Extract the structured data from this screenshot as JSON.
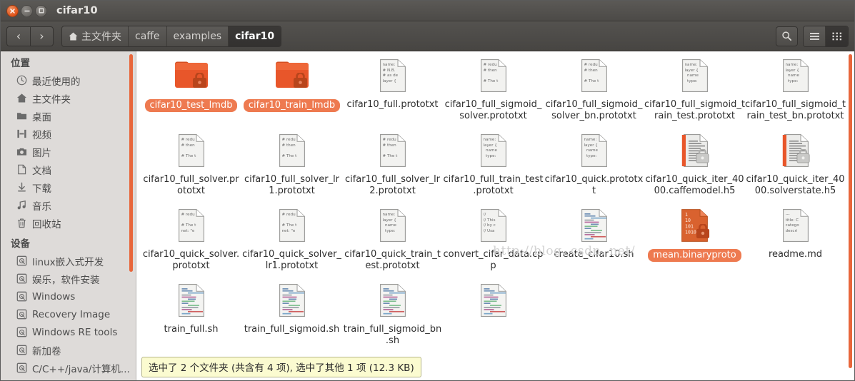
{
  "window": {
    "title": "cifar10",
    "controls": {
      "close": "×",
      "minimize": "−",
      "maximize": "□"
    }
  },
  "toolbar": {
    "back_label": "‹",
    "forward_label": "›",
    "breadcrumbs": [
      {
        "label": "主文件夹",
        "icon": "home-icon",
        "active": false
      },
      {
        "label": "caffe",
        "icon": "",
        "active": false
      },
      {
        "label": "examples",
        "icon": "",
        "active": false
      },
      {
        "label": "cifar10",
        "icon": "",
        "active": true
      }
    ],
    "search_icon": "search-icon",
    "list_view_icon": "list-view-icon",
    "grid_view_icon": "grid-view-icon",
    "active_view": "grid"
  },
  "sidebar": {
    "sections": [
      {
        "title": "位置",
        "items": [
          {
            "label": "最近使用的",
            "icon": "clock-icon"
          },
          {
            "label": "主文件夹",
            "icon": "home-icon"
          },
          {
            "label": "桌面",
            "icon": "folder-icon"
          },
          {
            "label": "视频",
            "icon": "video-icon"
          },
          {
            "label": "图片",
            "icon": "camera-icon"
          },
          {
            "label": "文档",
            "icon": "document-icon"
          },
          {
            "label": "下载",
            "icon": "download-icon"
          },
          {
            "label": "音乐",
            "icon": "music-icon"
          },
          {
            "label": "回收站",
            "icon": "trash-icon"
          }
        ]
      },
      {
        "title": "设备",
        "items": [
          {
            "label": "linux嵌入式开发",
            "icon": "drive-icon"
          },
          {
            "label": "娱乐，软件安装",
            "icon": "drive-icon"
          },
          {
            "label": "Windows",
            "icon": "drive-icon"
          },
          {
            "label": "Recovery Image",
            "icon": "drive-icon"
          },
          {
            "label": "Windows RE tools",
            "icon": "drive-icon"
          },
          {
            "label": "新加卷",
            "icon": "drive-icon"
          },
          {
            "label": "C/C++/java/计算机...",
            "icon": "drive-icon"
          }
        ]
      }
    ]
  },
  "files": [
    {
      "name": "cifar10_test_lmdb",
      "icon": "folder-locked-icon",
      "selected": true,
      "preview": []
    },
    {
      "name": "cifar10_train_lmdb",
      "icon": "folder-locked-icon",
      "selected": true,
      "preview": []
    },
    {
      "name": "cifar10_full.prototxt",
      "icon": "text-document-icon",
      "selected": false,
      "preview": [
        "name:",
        "# N.B.",
        "# as de",
        "layer {"
      ]
    },
    {
      "name": "cifar10_full_sigmoid_solver.prototxt",
      "icon": "text-document-icon",
      "selected": false,
      "preview": [
        "# redu",
        "# then",
        "",
        "# The t"
      ]
    },
    {
      "name": "cifar10_full_sigmoid_solver_bn.prototxt",
      "icon": "text-document-icon",
      "selected": false,
      "preview": [
        "# redu",
        "# then",
        "",
        "# The t"
      ]
    },
    {
      "name": "cifar10_full_sigmoid_train_test.prototxt",
      "icon": "text-document-icon",
      "selected": false,
      "preview": [
        "name:",
        "layer {",
        "  name",
        "  type:"
      ]
    },
    {
      "name": "cifar10_full_sigmoid_train_test_bn.prototxt",
      "icon": "text-document-icon",
      "selected": false,
      "preview": [
        "name:",
        "layer {",
        "  name",
        "  type:"
      ]
    },
    {
      "name": "cifar10_full_solver.prototxt",
      "icon": "text-document-icon",
      "selected": false,
      "preview": [
        "# redu",
        "# then",
        "",
        "# The t"
      ]
    },
    {
      "name": "cifar10_full_solver_lr1.prototxt",
      "icon": "text-document-icon",
      "selected": false,
      "preview": [
        "# redu",
        "# then",
        "",
        "# The t"
      ]
    },
    {
      "name": "cifar10_full_solver_lr2.prototxt",
      "icon": "text-document-icon",
      "selected": false,
      "preview": [
        "# redu",
        "# then",
        "",
        "# The t"
      ]
    },
    {
      "name": "cifar10_full_train_test.prototxt",
      "icon": "text-document-icon",
      "selected": false,
      "preview": [
        "name:",
        "layer {",
        "  name",
        "  type:"
      ]
    },
    {
      "name": "cifar10_quick.prototxt",
      "icon": "text-document-icon",
      "selected": false,
      "preview": [
        "name:",
        "layer {",
        "  name",
        "  type:"
      ]
    },
    {
      "name": "cifar10_quick_iter_4000.caffemodel.h5",
      "icon": "h5-locked-icon",
      "selected": false,
      "preview": []
    },
    {
      "name": "cifar10_quick_iter_4000.solverstate.h5",
      "icon": "h5-locked-icon",
      "selected": false,
      "preview": []
    },
    {
      "name": "cifar10_quick_solver.prototxt",
      "icon": "text-document-icon",
      "selected": false,
      "preview": [
        "# redu",
        "",
        "# The t",
        "net: \"e"
      ]
    },
    {
      "name": "cifar10_quick_solver_lr1.prototxt",
      "icon": "text-document-icon",
      "selected": false,
      "preview": [
        "# redu",
        "",
        "# The t",
        "net: \"e"
      ]
    },
    {
      "name": "cifar10_quick_train_test.prototxt",
      "icon": "text-document-icon",
      "selected": false,
      "preview": [
        "name:",
        "layer {",
        "  name",
        "  type:"
      ]
    },
    {
      "name": "convert_cifar_data.cpp",
      "icon": "text-document-icon",
      "selected": false,
      "preview": [
        "//",
        "// This",
        "// by c",
        "// Usa"
      ]
    },
    {
      "name": "create_cifar10.sh",
      "icon": "script-document-icon",
      "selected": false,
      "preview": []
    },
    {
      "name": "mean.binaryproto",
      "icon": "binary-locked-icon",
      "selected": true,
      "preview": [
        "1",
        "10",
        "101",
        "1010"
      ]
    },
    {
      "name": "readme.md",
      "icon": "text-document-icon",
      "selected": false,
      "preview": [
        "---",
        "title: C",
        "catego",
        "descri"
      ]
    },
    {
      "name": "train_full.sh",
      "icon": "script-document-icon",
      "selected": false,
      "preview": []
    },
    {
      "name": "train_full_sigmoid.sh",
      "icon": "script-document-icon",
      "selected": false,
      "preview": []
    },
    {
      "name": "train_full_sigmoid_bn.sh",
      "icon": "script-document-icon",
      "selected": false,
      "preview": []
    },
    {
      "name": "",
      "icon": "script-document-icon",
      "selected": false,
      "preview": []
    }
  ],
  "status": {
    "text": "选中了 2 个文件夹 (共含有 4 项), 选中了其他 1 项 (12.3 KB)"
  },
  "watermark": {
    "text": "http://blog. csdn. net/"
  },
  "colors": {
    "selection": "#ee7a50",
    "scrollbar": "#e8663b",
    "folder": "#e8562a",
    "titlebar": "#4c4a47",
    "sidebar": "#dedbd9",
    "status_bg": "#fbfbd0"
  }
}
